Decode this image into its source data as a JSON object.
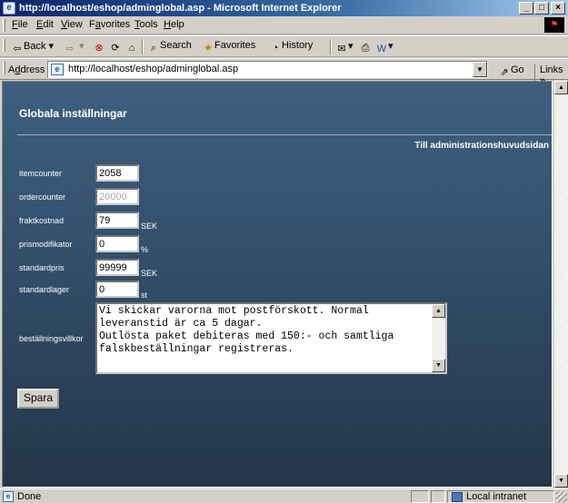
{
  "window": {
    "title": "http://localhost/eshop/adminglobal.asp - Microsoft Internet Explorer",
    "minimize": "_",
    "maximize": "□",
    "close": "×"
  },
  "menu": {
    "items": [
      {
        "pre": "",
        "key": "F",
        "post": "ile"
      },
      {
        "pre": "",
        "key": "E",
        "post": "dit"
      },
      {
        "pre": "",
        "key": "V",
        "post": "iew"
      },
      {
        "pre": "F",
        "key": "a",
        "post": "vorites"
      },
      {
        "pre": "",
        "key": "T",
        "post": "ools"
      },
      {
        "pre": "",
        "key": "H",
        "post": "elp"
      }
    ]
  },
  "toolbar": {
    "back": "Back",
    "search": "Search",
    "favorites": "Favorites",
    "history": "History"
  },
  "address": {
    "label_pre": "A",
    "label_key": "d",
    "label_post": "dress",
    "url": "http://localhost/eshop/adminglobal.asp",
    "go": "Go",
    "links": "Links",
    "links_more": "»"
  },
  "page": {
    "title": "Globala inställningar",
    "admin_link": "Till administrationshuvudsidan",
    "fields": {
      "itemcounter": {
        "label": "itemcounter",
        "value": "2058"
      },
      "ordercounter": {
        "label": "ordercounter",
        "value": "20000"
      },
      "fraktkostnad": {
        "label": "fraktkostnad",
        "value": "79",
        "unit": "SEK"
      },
      "prismodifikator": {
        "label": "prismodifikator",
        "value": "0",
        "unit": "%"
      },
      "standardpris": {
        "label": "standardpris",
        "value": "99999",
        "unit": "SEK"
      },
      "standardlager": {
        "label": "standardlager",
        "value": "0",
        "unit": "st"
      }
    },
    "bestallningsvillkor": {
      "label": "beställningsvillkor",
      "value": "Vi skickar varorna mot postförskott. Normal\nleveranstid är ca 5 dagar.\nOutlösta paket debiteras med 150:- och samtliga\nfalskbeställningar registreras."
    },
    "save": "Spara"
  },
  "status": {
    "text": "Done",
    "zone": "Local intranet"
  }
}
